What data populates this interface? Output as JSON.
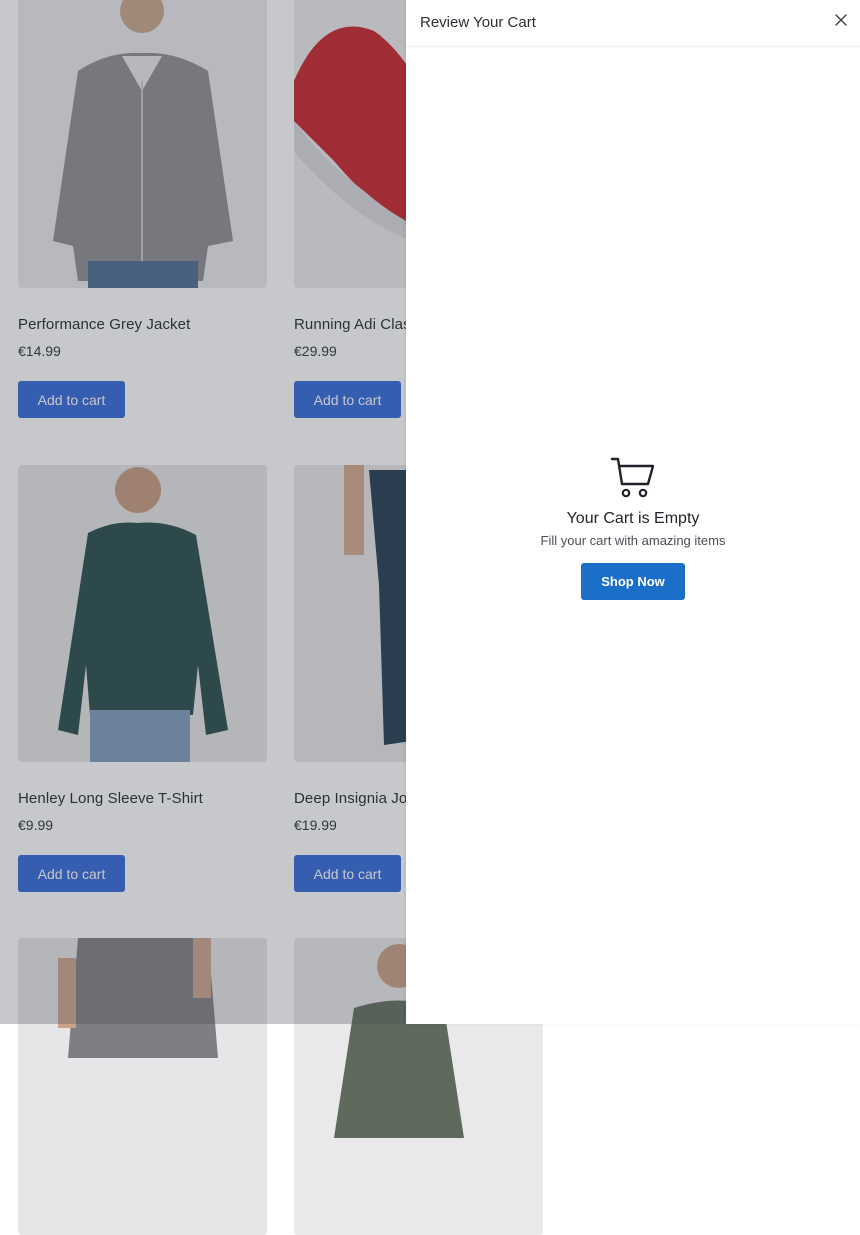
{
  "products": [
    {
      "title": "Performance Grey Jacket",
      "price": "€14.99",
      "button": "Add to cart"
    },
    {
      "title": "Running Adi Classic Shoes",
      "price": "€29.99",
      "button": "Add to cart"
    },
    {
      "title": "Henley Long Sleeve T-Shirt",
      "price": "€9.99",
      "button": "Add to cart"
    },
    {
      "title": "Deep Insignia Joggers",
      "price": "€19.99",
      "button": "Add to cart"
    }
  ],
  "cart": {
    "title": "Review Your Cart",
    "close_icon": "close-icon",
    "cart_icon": "shopping-cart-icon",
    "empty_title": "Your Cart is Empty",
    "empty_subtitle": "Fill your cart with amazing items",
    "shop_button": "Shop Now"
  },
  "colors": {
    "add_to_cart_button": "#2f66d8",
    "shop_now_button": "#1b6fc8",
    "overlay": "#464a52"
  }
}
